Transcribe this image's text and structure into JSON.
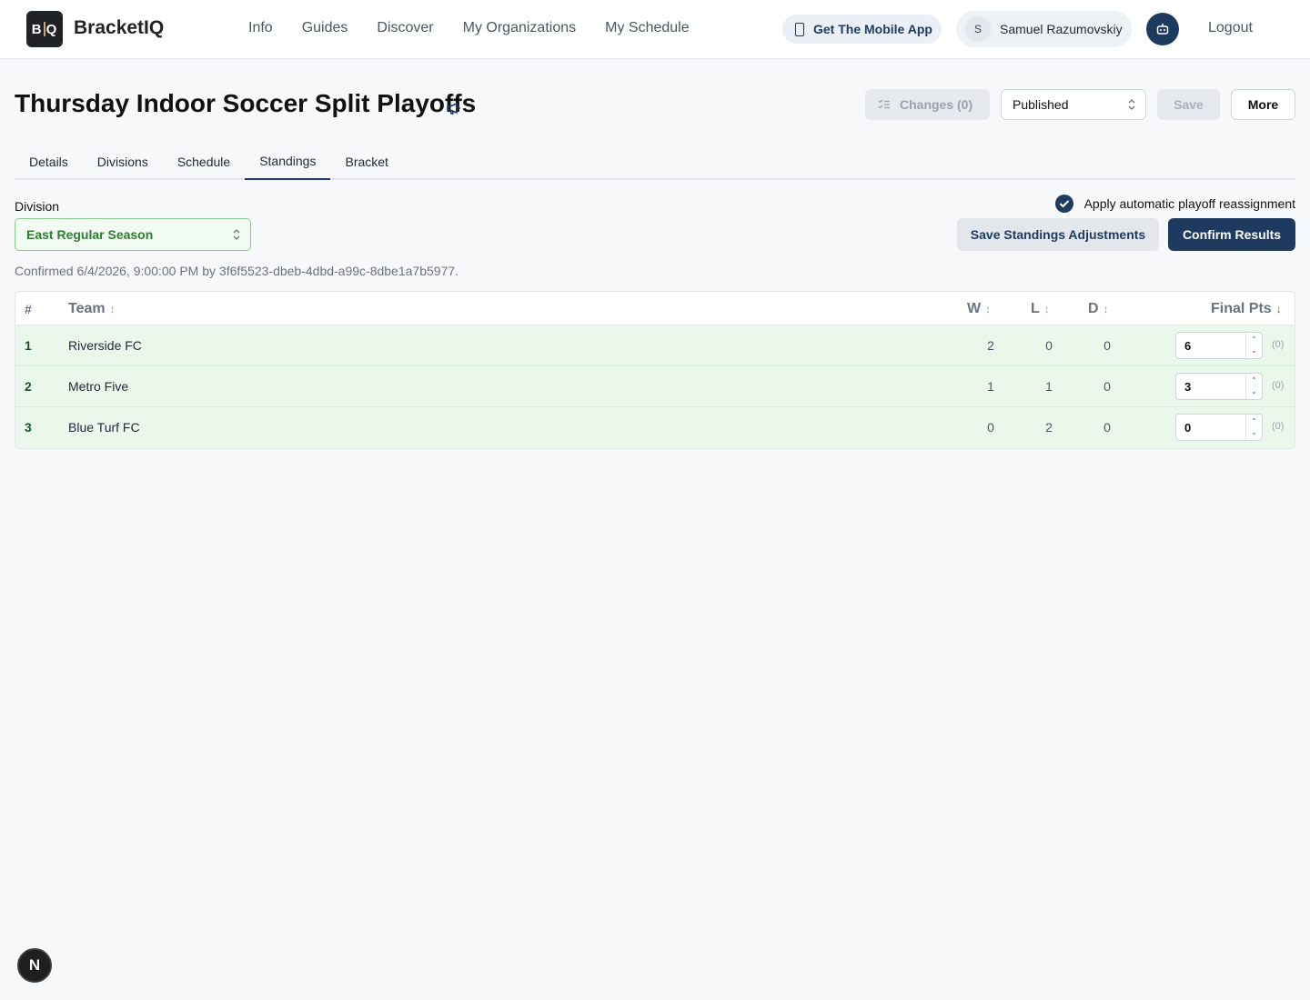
{
  "app": {
    "logo_text": "BQ",
    "brand": "BracketIQ"
  },
  "nav": {
    "items": [
      "Info",
      "Guides",
      "Discover",
      "My Organizations",
      "My Schedule"
    ]
  },
  "header": {
    "mobile_app_label": "Get The Mobile App",
    "user_initial": "S",
    "user_name": "Samuel Razumovskiy",
    "logout_label": "Logout"
  },
  "page": {
    "title": "Thursday Indoor Soccer Split Playoffs",
    "changes_label": "Changes (0)",
    "status_selected": "Published",
    "save_label": "Save",
    "more_label": "More"
  },
  "tabs": [
    {
      "label": "Details",
      "active": false
    },
    {
      "label": "Divisions",
      "active": false
    },
    {
      "label": "Schedule",
      "active": false
    },
    {
      "label": "Standings",
      "active": true
    },
    {
      "label": "Bracket",
      "active": false
    }
  ],
  "standings": {
    "division_label": "Division",
    "division_selected": "East Regular Season",
    "auto_reassign_label": "Apply automatic playoff reassignment",
    "auto_reassign_checked": true,
    "save_adjustments_label": "Save Standings Adjustments",
    "confirm_label": "Confirm Results",
    "confirmed_text": "Confirmed 6/4/2026, 9:00:00 PM by 3f6f5523-dbeb-4dbd-a99c-8dbe1a7b5977.",
    "columns": {
      "rank": "#",
      "team": "Team",
      "w": "W",
      "l": "L",
      "d": "D",
      "pts": "Final Pts"
    },
    "rows": [
      {
        "rank": "1",
        "team": "Riverside FC",
        "w": "2",
        "l": "0",
        "d": "0",
        "pts": "6",
        "adj": "(0)"
      },
      {
        "rank": "2",
        "team": "Metro Five",
        "w": "1",
        "l": "1",
        "d": "0",
        "pts": "3",
        "adj": "(0)"
      },
      {
        "rank": "3",
        "team": "Blue Turf FC",
        "w": "0",
        "l": "2",
        "d": "0",
        "pts": "0",
        "adj": "(0)"
      }
    ]
  },
  "fab": {
    "label": "N"
  },
  "colors": {
    "primary": "#1e3a5f",
    "row_highlight": "#eaf8ec",
    "division_text": "#2e7d32"
  }
}
